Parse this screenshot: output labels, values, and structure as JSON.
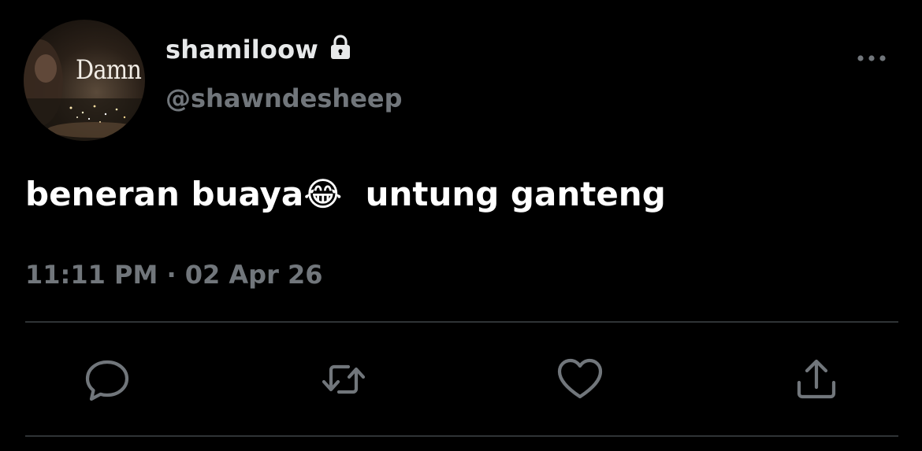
{
  "tweet": {
    "avatar_text": "Damn",
    "display_name": "shamiloow",
    "handle": "@shawndesheep",
    "text": "beneran buaya😂  untung ganteng",
    "time": "11:11 PM",
    "separator": "·",
    "date": "02 Apr 26"
  },
  "icons": {
    "lock": "lock-icon",
    "more": "more-horizontal-icon",
    "reply": "reply-icon",
    "retweet": "retweet-icon",
    "like": "heart-icon",
    "share": "share-icon"
  },
  "colors": {
    "background": "#000000",
    "primary_text": "#e7e9ea",
    "secondary_text": "#71767b",
    "divider": "#2f3336"
  }
}
